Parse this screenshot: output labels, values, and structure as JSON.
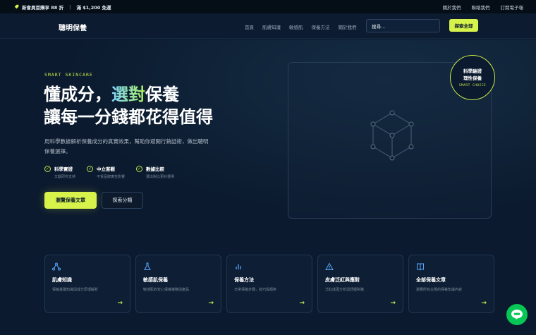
{
  "topbar": {
    "promo_main": "新會員首購享 88 折",
    "promo_sub": "滿 $1,200 免運",
    "links": [
      "關於我們",
      "聯絡我們",
      "訂閱電子報"
    ]
  },
  "nav": {
    "logo": "聰明保養",
    "menu": [
      "首頁",
      "肌膚知識",
      "敏感肌",
      "保養方法",
      "關於我們"
    ],
    "search_placeholder": "搜尋...",
    "search_button": "探索全部"
  },
  "hero": {
    "kicker": "SMART SKINCARE",
    "title_line1_pre": "懂成分，",
    "title_line1_highlight": "選對",
    "title_line1_post": "保養",
    "title_line2": "讓每一分錢都花得值得",
    "description": "用科學數據解析保養成分的真實效果，幫助你避開行銷話術，做出聰明保養選擇。",
    "features": [
      {
        "title": "科學實證",
        "sub": "文獻研究支持"
      },
      {
        "title": "中立客觀",
        "sub": "不受品牌廣告影響"
      },
      {
        "title": "數據比較",
        "sub": "選出對比更好選擇"
      }
    ],
    "cta_primary": "瀏覽保養文章",
    "cta_secondary": "探索分類"
  },
  "seal": {
    "line1": "科學驗證",
    "line2": "理性保養",
    "en": "SMART CHOICE"
  },
  "categories": [
    {
      "icon": "molecule-icon",
      "title": "肌膚知識",
      "sub": "保養基礎知識與成分原理解析"
    },
    {
      "icon": "flask-icon",
      "title": "敏感肌保養",
      "sub": "敏感肌的安心保養策略與產品"
    },
    {
      "icon": "bar-chart-icon",
      "title": "保養方法",
      "sub": "日常保養步驟，技巧與順序"
    },
    {
      "icon": "warning-icon",
      "title": "皮膚泛紅與應對",
      "sub": "泛紅成因分析與舒緩對策"
    },
    {
      "icon": "book-icon",
      "title": "全部保養文章",
      "sub": "瀏覽所有主題的保養知識內容"
    }
  ],
  "colors": {
    "background": "#0b1a2e",
    "accent": "#d6f24b",
    "line_green": "#06c755"
  }
}
